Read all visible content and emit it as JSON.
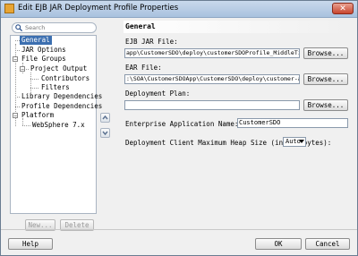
{
  "window": {
    "title": "Edit EJB JAR Deployment Profile Properties",
    "close_label": "✕"
  },
  "search": {
    "placeholder": "Search"
  },
  "tree": {
    "general": "General",
    "jar_options": "JAR Options",
    "file_groups": "File Groups",
    "project_output": "Project Output",
    "contributors": "Contributors",
    "filters": "Filters",
    "library_dependencies": "Library Dependencies",
    "profile_dependencies": "Profile Dependencies",
    "platform": "Platform",
    "websphere": "WebSphere 7.x"
  },
  "tree_buttons": {
    "new": "New...",
    "delete": "Delete"
  },
  "section": {
    "title": "General"
  },
  "form": {
    "ejb_jar_label": "EJB JAR File:",
    "ejb_jar_value": "app\\CustomerSDO\\deploy\\customerSDOProfile_MiddleTier.jar",
    "ear_label": "EAR File:",
    "ear_value": ":\\SOA\\CustomerSDOApp\\CustomerSDO\\deploy\\customer-app.ear",
    "plan_label": "Deployment Plan:",
    "plan_value": "",
    "browse": "Browse...",
    "app_name_label": "Enterprise Application Name:",
    "app_name_value": "CustomerSDO",
    "heap_label": "Deployment Client Maximum Heap Size (in Megabytes):",
    "heap_value": "Auto"
  },
  "footer": {
    "help": "Help",
    "ok": "OK",
    "cancel": "Cancel"
  }
}
